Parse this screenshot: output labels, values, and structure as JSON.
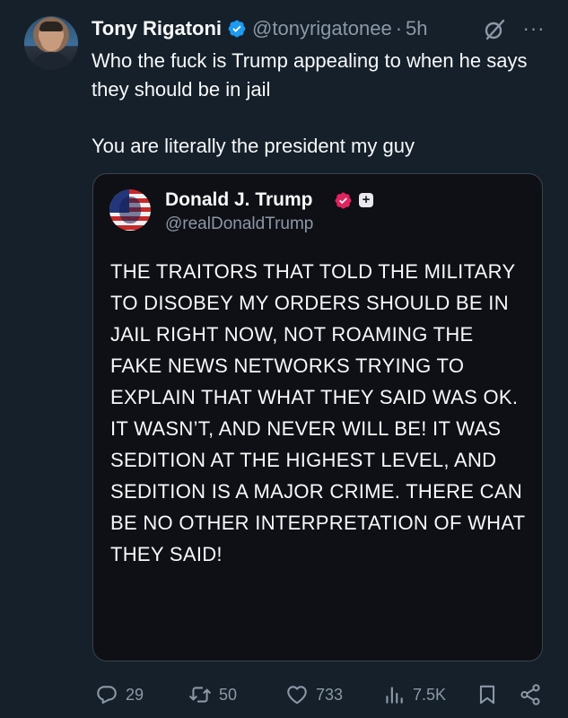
{
  "tweet": {
    "author_name": "Tony Rigatoni",
    "handle": "@tonyrigatonee",
    "separator": "·",
    "time": "5h",
    "paragraphs": [
      "Who the fuck is Trump appealing to when he says they should be in jail",
      "You are literally the president my guy"
    ]
  },
  "quoted_post": {
    "author_name": "Donald J. Trump",
    "handle": "@realDonaldTrump",
    "plus_badge": "+",
    "body": "THE TRAITORS THAT TOLD THE MILITARY TO DISOBEY MY ORDERS SHOULD BE IN JAIL RIGHT NOW, NOT ROAMING THE FAKE NEWS NETWORKS TRYING TO EXPLAIN THAT WHAT THEY SAID WAS OK. IT WASN’T, AND NEVER WILL BE! IT WAS SEDITION AT THE HIGHEST LEVEL, AND SEDITION IS A MAJOR CRIME. THERE CAN BE NO OTHER INTERPRETATION OF WHAT THEY SAID!"
  },
  "actions": {
    "replies": "29",
    "reposts": "50",
    "likes": "733",
    "views": "7.5K"
  },
  "more_label": "···",
  "icons": {
    "author_badge": "verified-badge-icon",
    "quoted_badge": "government-badge-icon",
    "grok": "grok-icon",
    "more": "more-icon",
    "reply": "reply-icon",
    "repost": "repost-icon",
    "like": "like-icon",
    "views": "views-icon",
    "bookmark": "bookmark-icon",
    "share": "share-icon"
  },
  "colors": {
    "background": "#15202b",
    "quote_background": "#0f0f16",
    "text": "#f7f9f9",
    "secondary_text": "#8b98a5",
    "verified_blue": "#1d9bf0",
    "government_badge": "#e0245e"
  }
}
